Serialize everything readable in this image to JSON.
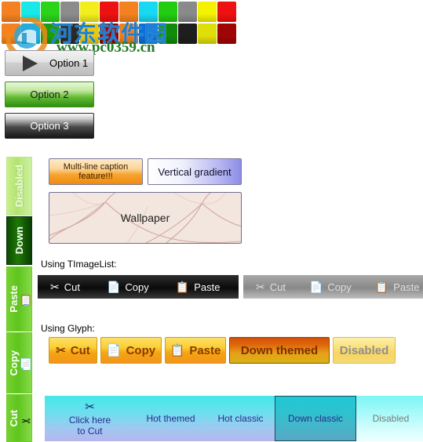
{
  "swatches": {
    "row1": [
      "#f58220",
      "#18e8e8",
      "#2bd41a",
      "#8c8c8c",
      "#f2ee1e",
      "#ee1111",
      "#f58220",
      "#18d8f2",
      "#22cc11",
      "#8a8a8a",
      "#f5f200",
      "#ee1111"
    ],
    "row2": [
      "#f58220",
      "#0fb7e8",
      "#1a9e0d",
      "#2a2a2a",
      "#e8c910",
      "#8c0606",
      "#f07e1a",
      "#0a6fd8",
      "#118a08",
      "#1e1e1e",
      "#e0de08",
      "#a00505"
    ]
  },
  "watermark": {
    "logo_name": "site-logo",
    "cn_text": "河东软件园",
    "url_text": "www.pc0359.cn"
  },
  "options": {
    "items": [
      {
        "label": "Option 1",
        "icon": "play-triangle-icon"
      },
      {
        "label": "Option 2",
        "icon": ""
      },
      {
        "label": "Option 3",
        "icon": ""
      }
    ]
  },
  "vertical_tabs": {
    "items": [
      {
        "label": "Disabled",
        "icon": ""
      },
      {
        "label": "Down",
        "icon": ""
      },
      {
        "label": "Paste",
        "icon": "📋"
      },
      {
        "label": "Copy",
        "icon": "📄"
      },
      {
        "label": "Cut",
        "icon": "✂"
      }
    ]
  },
  "gradient_buttons": {
    "multiline": "Multi-line caption feature!!!",
    "vertical_gradient": "Vertical gradient",
    "wallpaper": "Wallpaper"
  },
  "sections": {
    "imagelist_label": "Using TImageList:",
    "glyph_label": "Using Glyph:"
  },
  "imagelist_toolbar_enabled": {
    "items": [
      {
        "label": "Cut",
        "icon": "✂"
      },
      {
        "label": "Copy",
        "icon": "📄"
      },
      {
        "label": "Paste",
        "icon": "📋"
      }
    ]
  },
  "imagelist_toolbar_disabled": {
    "items": [
      {
        "label": "Cut",
        "icon": "✂"
      },
      {
        "label": "Copy",
        "icon": "📄"
      },
      {
        "label": "Paste",
        "icon": "📋"
      }
    ]
  },
  "glyph_buttons": {
    "cut": {
      "label": "Cut",
      "icon": "✂"
    },
    "copy": {
      "label": "Copy",
      "icon": "📄"
    },
    "paste": {
      "label": "Paste",
      "icon": "📋"
    },
    "down_themed": {
      "label": "Down themed"
    },
    "disabled": {
      "label": "Disabled"
    }
  },
  "cyan_panel": {
    "cut": {
      "label": "Click here\nto Cut",
      "line1": "Click here",
      "line2": "to Cut",
      "icon": "✂"
    },
    "hot_themed": "Hot themed",
    "hot_classic": "Hot classic",
    "down_classic": "Down classic",
    "disabled": "Disabled"
  },
  "colors": {
    "accent_green": "#5fc41c",
    "accent_orange": "#f5a413",
    "accent_cyan": "#44e8e8",
    "watermark_blue": "#1b7fd4",
    "watermark_green": "#1f7a22"
  }
}
